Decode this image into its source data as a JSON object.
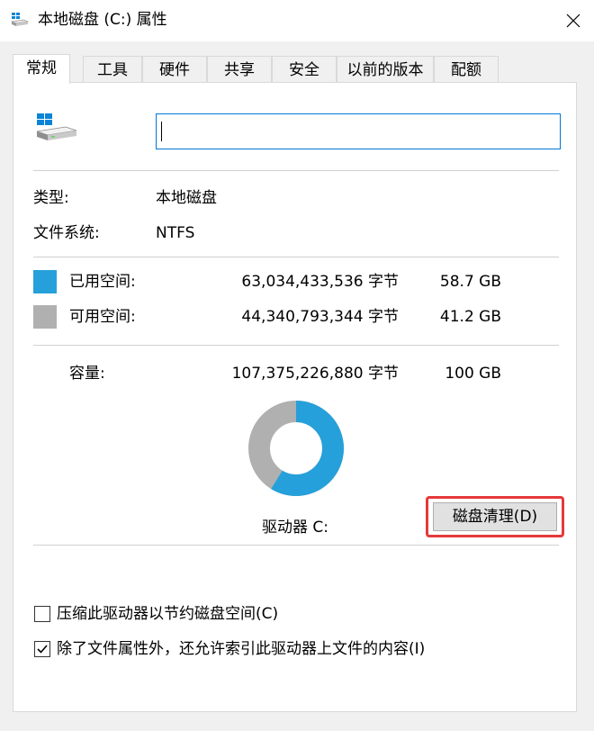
{
  "window": {
    "title": "本地磁盘 (C:) 属性",
    "close_glyph": "✕"
  },
  "tabs": [
    {
      "label": "常规",
      "active": true
    },
    {
      "label": "工具",
      "active": false
    },
    {
      "label": "硬件",
      "active": false
    },
    {
      "label": "共享",
      "active": false
    },
    {
      "label": "安全",
      "active": false
    },
    {
      "label": "以前的版本",
      "active": false
    },
    {
      "label": "配额",
      "active": false
    }
  ],
  "general": {
    "drive_icon": "drive-icon",
    "name_value": "",
    "type_label": "类型:",
    "type_value": "本地磁盘",
    "fs_label": "文件系统:",
    "fs_value": "NTFS",
    "used": {
      "label": "已用空间:",
      "bytes": "63,034,433,536 字节",
      "size": "58.7 GB",
      "color": "#26a0da"
    },
    "free": {
      "label": "可用空间:",
      "bytes": "44,340,793,344 字节",
      "size": "41.2 GB",
      "color": "#b0b0b0"
    },
    "capacity": {
      "label": "容量:",
      "bytes": "107,375,226,880 字节",
      "size": "100 GB"
    },
    "usage_fraction": 0.587,
    "drive_label": "驱动器 C:",
    "cleanup_button": "磁盘清理(D)",
    "highlight_color": "#e5393a"
  },
  "options": {
    "compress": {
      "label": "压缩此驱动器以节约磁盘空间(C)",
      "checked": false
    },
    "index": {
      "label": "除了文件属性外，还允许索引此驱动器上文件的内容(I)",
      "checked": true
    }
  }
}
